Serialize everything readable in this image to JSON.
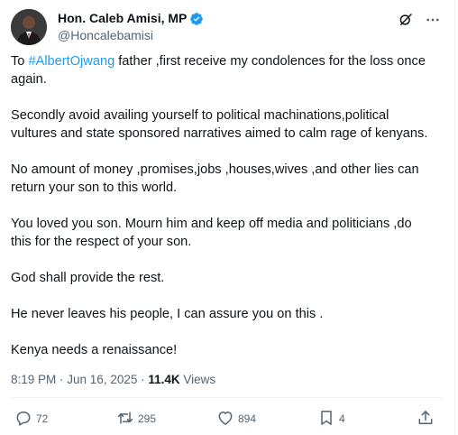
{
  "author": {
    "display_name": "Hon. Caleb Amisi, MP",
    "handle": "@Honcalebamisi",
    "verified_icon": "verified-badge-icon",
    "verified_color": "#1d9bf0"
  },
  "header_actions": {
    "grok_icon": "grok-icon",
    "more_icon": "more-options-icon"
  },
  "post": {
    "intro_prefix": "To ",
    "hashtag": "#AlbertOjwang",
    "intro_suffix": " father ,first receive my condolences for the loss once again.",
    "paragraphs": [
      "Secondly avoid availing yourself to political machinations,political vultures and state sponsored narratives aimed to calm rage of kenyans.",
      "No amount of money ,promises,jobs ,houses,wives ,and other lies can return your son to this world.",
      "You loved you son. Mourn him and keep off media and politicians ,do this for the respect of your son.",
      "God shall provide the rest.",
      "He never leaves his people, I can assure you on this .",
      "Kenya needs a renaissance!"
    ]
  },
  "meta": {
    "time": "8:19 PM",
    "separator": " · ",
    "date": "Jun 16, 2025",
    "views_count": "11.4K",
    "views_label": " Views"
  },
  "actions": {
    "replies": "72",
    "reposts": "295",
    "likes": "894",
    "bookmarks": "4"
  },
  "colors": {
    "text": "#0f1419",
    "secondary": "#536471",
    "accent": "#1d9bf0",
    "divider": "#eff3f4"
  }
}
